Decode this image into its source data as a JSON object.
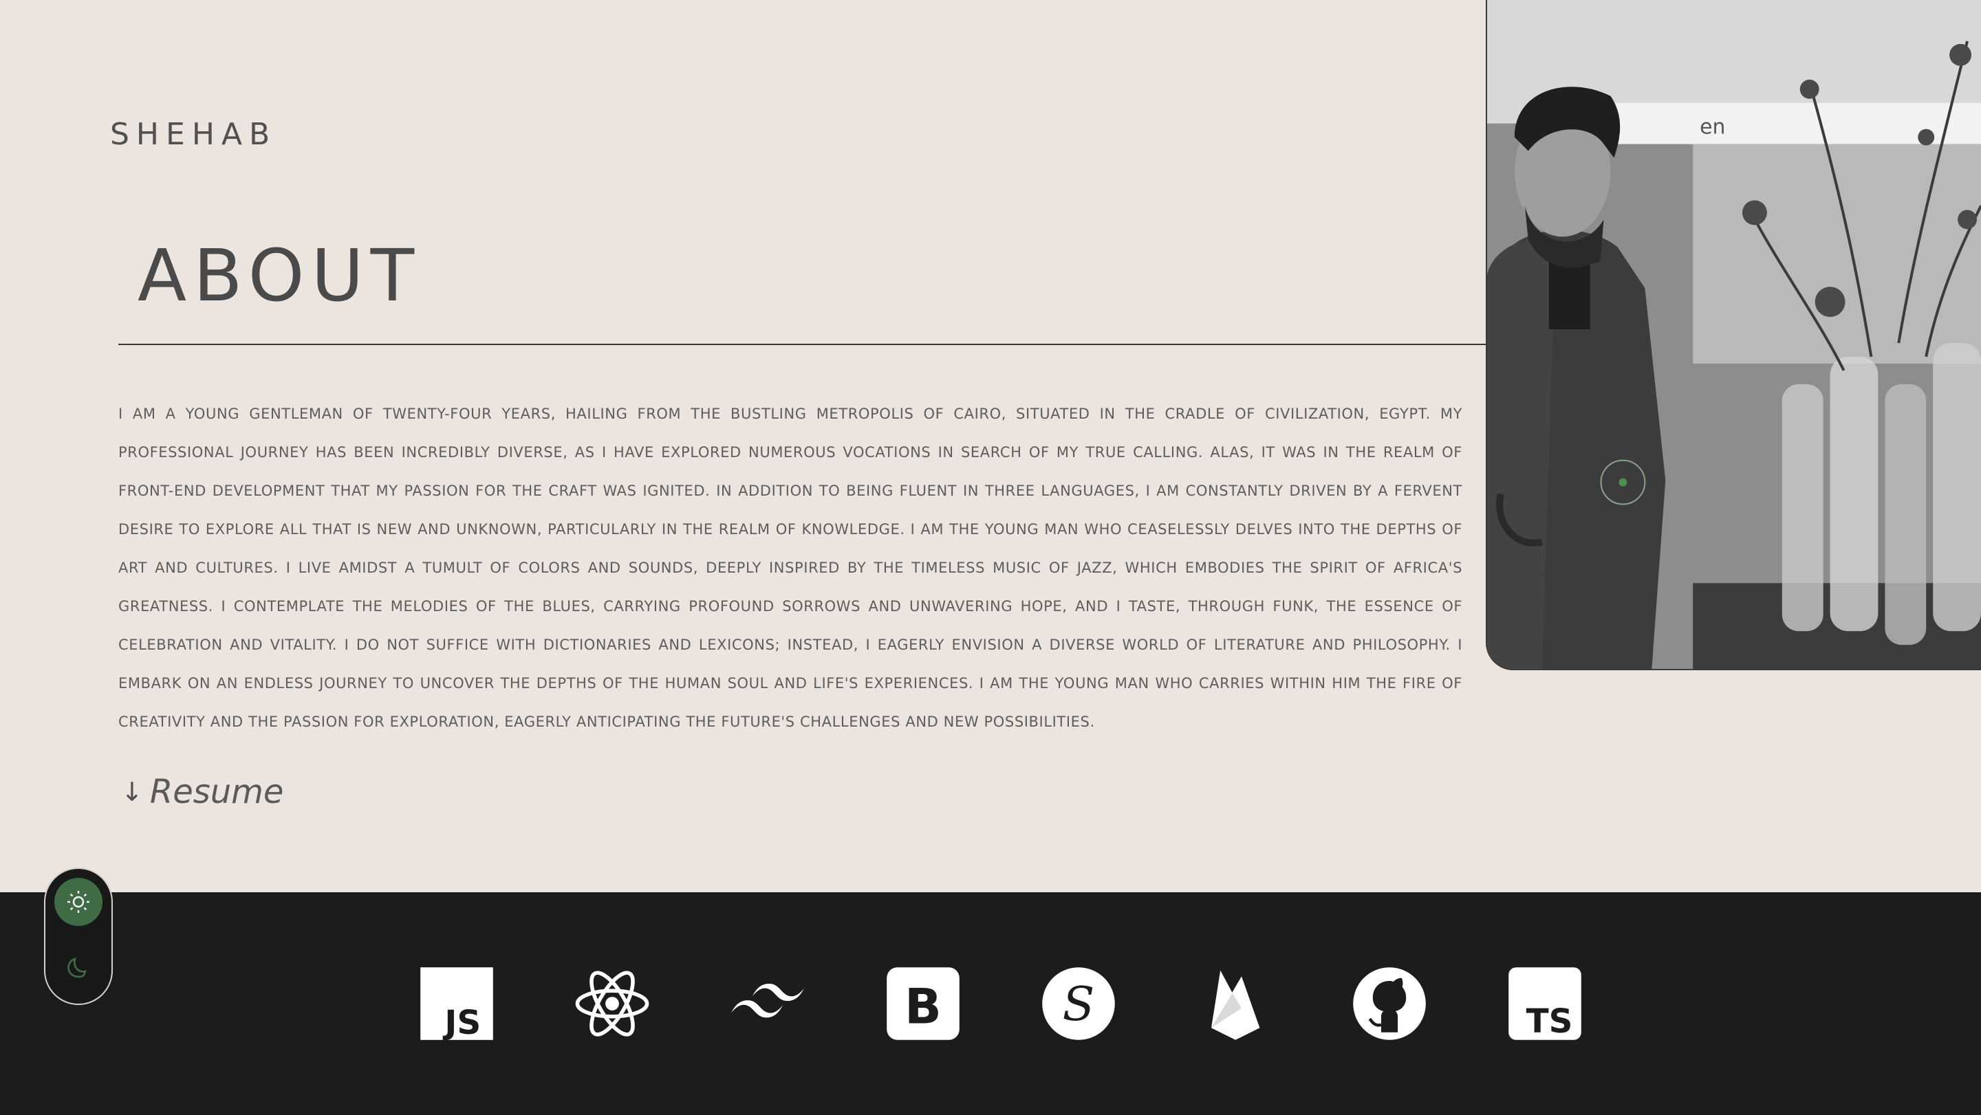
{
  "brand": {
    "logo": "SHEHAB"
  },
  "about": {
    "title": "ABOUT",
    "text": "I am a young gentleman of twenty-four years, hailing from the bustling metropolis of Cairo, situated in the cradle of civilization, Egypt. My professional journey has been incredibly diverse, as I have explored numerous vocations in search of my true calling. Alas, it was in the realm of front-end development that my passion for the craft was ignited. In addition to being fluent in three languages, I am constantly driven by a fervent desire to explore all that is new and unknown, particularly in the realm of knowledge. I am the young man who ceaselessly delves into the depths of art and cultures. I live amidst a tumult of colors and sounds, deeply inspired by the timeless music of jazz, which embodies the spirit of Africa's greatness. I contemplate the melodies of the blues, carrying profound sorrows and unwavering hope, and I taste, through funk, the essence of celebration and vitality. I do not suffice with dictionaries and lexicons; instead, I eagerly envision a diverse world of literature and philosophy. I embark on an endless journey to uncover the depths of the human soul and life's experiences. I am the young man who carries within him the fire of creativity and the passion for exploration, eagerly anticipating the future's challenges and new possibilities.",
    "resume_label": "Resume"
  },
  "photo": {
    "sign_text": "en"
  },
  "theme": {
    "active": "light",
    "accent": "#3f6b45"
  },
  "tech_stack": [
    {
      "icon": "javascript-icon",
      "text": "JS"
    },
    {
      "icon": "react-icon",
      "text": ""
    },
    {
      "icon": "tailwind-icon",
      "text": ""
    },
    {
      "icon": "bootstrap-icon",
      "text": "B"
    },
    {
      "icon": "sass-icon",
      "text": "S"
    },
    {
      "icon": "firebase-icon",
      "text": ""
    },
    {
      "icon": "github-icon",
      "text": ""
    },
    {
      "icon": "typescript-icon",
      "text": "TS"
    }
  ],
  "colors": {
    "background": "#ece4df",
    "text": "#5d5d5d",
    "footer": "#1c1c1c",
    "icon": "#ffffff"
  }
}
